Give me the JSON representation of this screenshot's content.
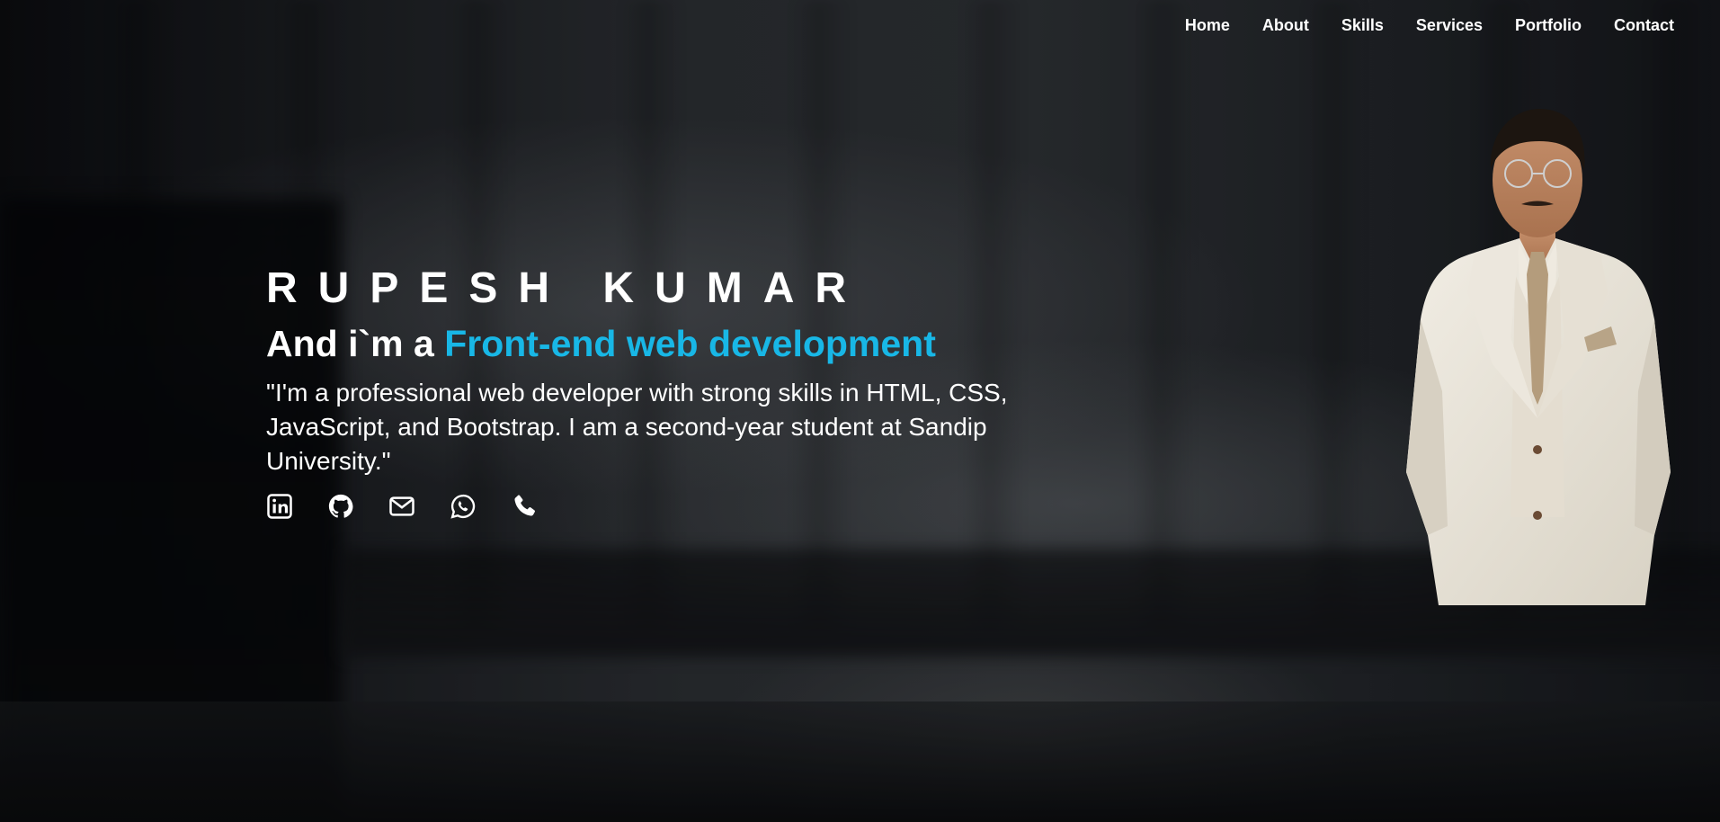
{
  "nav": {
    "items": [
      {
        "label": "Home"
      },
      {
        "label": "About"
      },
      {
        "label": "Skills"
      },
      {
        "label": "Services"
      },
      {
        "label": "Portfolio"
      },
      {
        "label": "Contact"
      }
    ]
  },
  "hero": {
    "name": "RUPESH KUMAR",
    "tagline_prefix": "And i`m a ",
    "tagline_highlight": "Front-end web development",
    "description": "\"I'm a professional web developer with strong skills in HTML, CSS, JavaScript, and Bootstrap. I am a second-year student at Sandip University.\"",
    "accent_color": "#18b7e6"
  },
  "socials": [
    {
      "icon": "linkedin-icon"
    },
    {
      "icon": "github-icon"
    },
    {
      "icon": "envelope-icon"
    },
    {
      "icon": "whatsapp-icon"
    },
    {
      "icon": "phone-icon"
    }
  ]
}
